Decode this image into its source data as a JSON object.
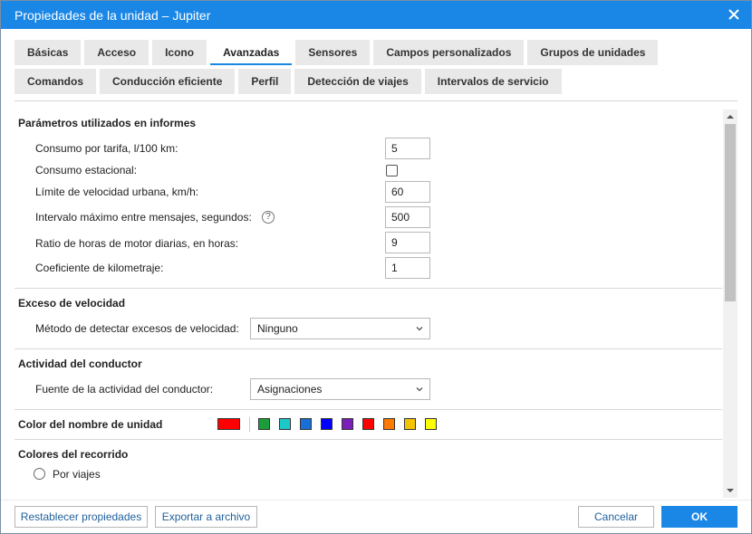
{
  "window": {
    "title": "Propiedades de la unidad – Jupiter"
  },
  "tabs": {
    "row1": [
      "Básicas",
      "Acceso",
      "Icono",
      "Avanzadas",
      "Sensores",
      "Campos personalizados",
      "Grupos de unidades"
    ],
    "row2": [
      "Comandos",
      "Conducción eficiente",
      "Perfil",
      "Detección de viajes",
      "Intervalos de servicio"
    ],
    "active": "Avanzadas"
  },
  "report_params": {
    "title": "Parámetros utilizados en informes",
    "rows": [
      {
        "label": "Consumo por tarifa, l/100 km:",
        "value": "5"
      },
      {
        "label": "Consumo estacional:",
        "checked": false
      },
      {
        "label": "Límite de velocidad urbana, km/h:",
        "value": "60"
      },
      {
        "label": "Intervalo máximo entre mensajes, segundos:",
        "value": "500",
        "help": "?"
      },
      {
        "label": "Ratio de horas de motor diarias, en horas:",
        "value": "9"
      },
      {
        "label": "Coeficiente de kilometraje:",
        "value": "1"
      }
    ]
  },
  "speeding": {
    "title": "Exceso de velocidad",
    "label": "Método de detectar excesos de velocidad:",
    "selected": "Ninguno"
  },
  "driver_activity": {
    "title": "Actividad del conductor",
    "label": "Fuente de la actividad del conductor:",
    "selected": "Asignaciones"
  },
  "unit_name_color": {
    "title": "Color del nombre de unidad",
    "selected_color": "#ff0000",
    "palette": [
      "#1a9e3a",
      "#1ec8c8",
      "#1a6fd6",
      "#0000ff",
      "#7a1fb8",
      "#ff0000",
      "#ff7a00",
      "#f5c400",
      "#ffff00"
    ]
  },
  "track_colors": {
    "title": "Colores del recorrido",
    "option1": "Por viajes"
  },
  "footer": {
    "reset": "Restablecer propiedades",
    "export": "Exportar a archivo",
    "cancel": "Cancelar",
    "ok": "OK"
  },
  "colors": {
    "accent": "#1a87e6"
  }
}
